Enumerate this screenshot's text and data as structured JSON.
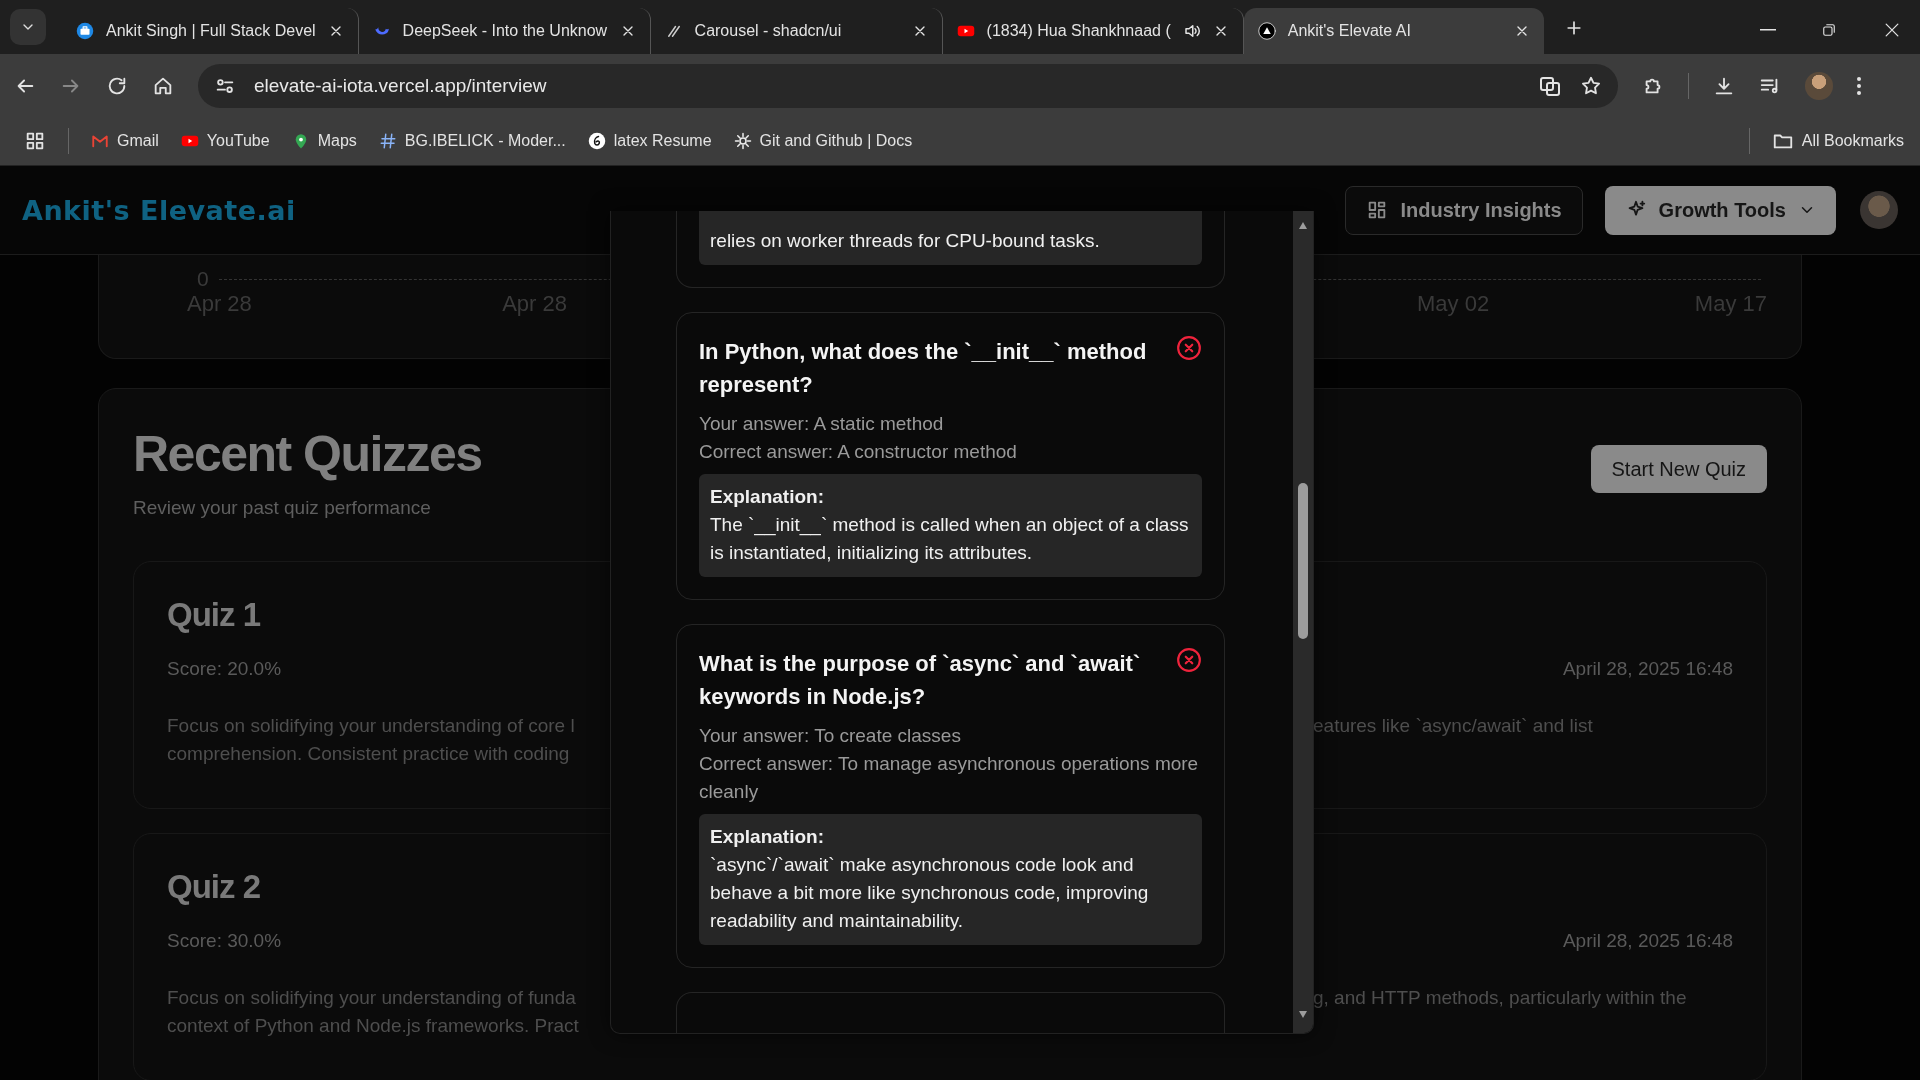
{
  "browser": {
    "tabs": [
      {
        "title": "Ankit Singh | Full Stack Devel",
        "selected": false,
        "audio": false
      },
      {
        "title": "DeepSeek - Into the Unknow",
        "selected": false,
        "audio": false
      },
      {
        "title": "Carousel - shadcn/ui",
        "selected": false,
        "audio": false
      },
      {
        "title": "(1834) Hua Shankhnaad (",
        "selected": false,
        "audio": true
      },
      {
        "title": "Ankit's Elevate AI",
        "selected": true,
        "audio": false
      }
    ],
    "address": "elevate-ai-iota.vercel.app/interview",
    "bookmarks": [
      {
        "label": "Gmail"
      },
      {
        "label": "YouTube"
      },
      {
        "label": "Maps"
      },
      {
        "label": "BG.IBELICK - Moder..."
      },
      {
        "label": "latex Resume"
      },
      {
        "label": "Git and Github | Docs"
      }
    ],
    "all_bookmarks": "All Bookmarks"
  },
  "app": {
    "logo": "Ankit's Elevate.ai",
    "nav": [
      {
        "label": "Industry Insights",
        "kind": "outline"
      },
      {
        "label": "Growth Tools",
        "kind": "filled"
      }
    ]
  },
  "chart": {
    "y_tick": "0",
    "x_labels_left": [
      "Apr 28",
      "Apr 28"
    ],
    "x_labels_right": [
      "May 02",
      "May 17"
    ]
  },
  "quizzes": {
    "title": "Recent Quizzes",
    "subtitle": "Review your past quiz performance",
    "button": "Start New Quiz",
    "items": [
      {
        "title": "Quiz 1",
        "score": "Score: 20.0%",
        "date": "April 28, 2025 16:48",
        "summary_left": [
          "Focus on solidifying your understanding of core l",
          "comprehension. Consistent practice with coding"
        ],
        "summary_right": [
          "eatures like `async/await` and list"
        ]
      },
      {
        "title": "Quiz 2",
        "score": "Score: 30.0%",
        "date": "April 28, 2025 16:48",
        "summary_left": [
          "Focus on solidifying your understanding of funda",
          "context of Python and Node.js frameworks. Pract"
        ],
        "summary_right": [
          "g, and HTTP methods, particularly within the"
        ]
      }
    ]
  },
  "dialog": {
    "top_explanation": "relies on worker threads for CPU-bound tasks.",
    "questions": [
      {
        "question": "In Python, what does the `__init__` method represent?",
        "your_answer": "Your answer: A static method",
        "correct_answer": "Correct answer: A constructor method",
        "explanation_label": "Explanation:",
        "explanation": "The `__init__` method is called when an object of a class is instantiated, initializing its attributes.",
        "correct": false
      },
      {
        "question": "What is the purpose of `async` and `await` keywords in Node.js?",
        "your_answer": "Your answer: To create classes",
        "correct_answer": "Correct answer: To manage asynchronous operations more cleanly",
        "explanation_label": "Explanation:",
        "explanation": "`async`/`await` make asynchronous code look and behave a bit more like synchronous code, improving readability and maintainability.",
        "correct": false
      }
    ]
  }
}
